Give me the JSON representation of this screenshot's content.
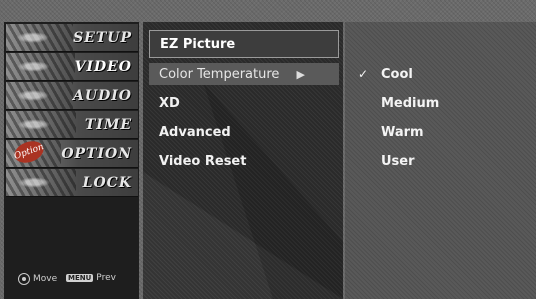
{
  "sidebar": {
    "items": [
      {
        "label": "SETUP"
      },
      {
        "label": "VIDEO"
      },
      {
        "label": "AUDIO"
      },
      {
        "label": "TIME"
      },
      {
        "label": "OPTION",
        "badge": "Option"
      },
      {
        "label": "LOCK"
      }
    ],
    "hints": {
      "move_label": "Move",
      "menu_key": "MENU",
      "prev_label": "Prev"
    }
  },
  "menu": {
    "header": "EZ Picture",
    "items": [
      {
        "label": "Color Temperature",
        "arrow": "▶"
      },
      {
        "label": "XD"
      },
      {
        "label": "Advanced"
      },
      {
        "label": "Video Reset"
      }
    ]
  },
  "submenu": {
    "check_mark": "✓",
    "options": [
      {
        "label": "Cool"
      },
      {
        "label": "Medium"
      },
      {
        "label": "Warm"
      },
      {
        "label": "User"
      }
    ]
  }
}
